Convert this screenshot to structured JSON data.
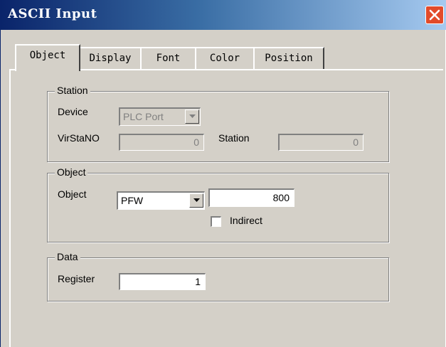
{
  "window": {
    "title": "ASCII Input"
  },
  "tabs": [
    {
      "label": "Object"
    },
    {
      "label": "Display"
    },
    {
      "label": "Font"
    },
    {
      "label": "Color"
    },
    {
      "label": "Position"
    }
  ],
  "station": {
    "legend": "Station",
    "device_label": "Device",
    "device_value": "PLC Port",
    "virstano_label": "VirStaNO",
    "virstano_value": "0",
    "station_label": "Station",
    "station_value": "0"
  },
  "object": {
    "legend": "Object",
    "object_label": "Object",
    "object_type": "PFW",
    "address": "800",
    "indirect_label": "Indirect",
    "indirect_checked": false
  },
  "data": {
    "legend": "Data",
    "register_label": "Register",
    "register_value": "1"
  },
  "icons": {
    "close": "close-icon",
    "dropdown": "chevron-down-icon"
  },
  "colors": {
    "titlebar": "#0a246a",
    "close": "#e24b2a",
    "face": "#d4d0c8"
  }
}
